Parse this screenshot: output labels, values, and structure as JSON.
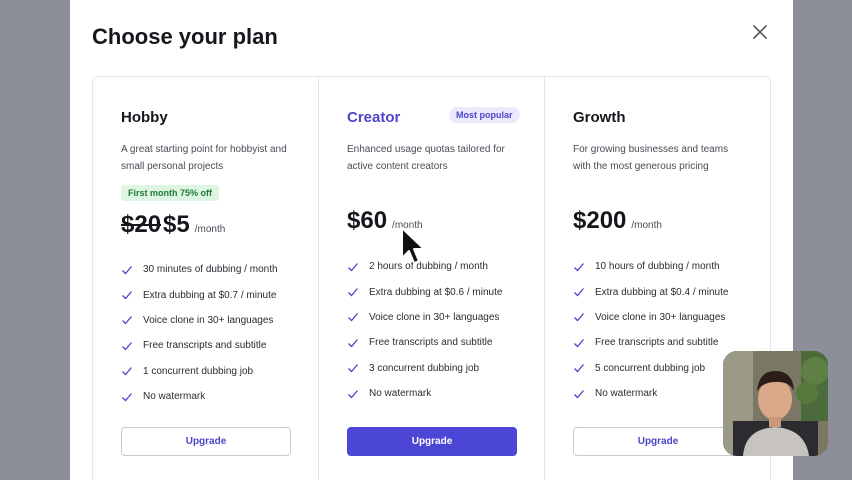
{
  "modal": {
    "title": "Choose your plan"
  },
  "colors": {
    "accent": "#4b46d6",
    "promo_bg": "#def5e2",
    "promo_text": "#1f7a37",
    "check": "#4b46c8"
  },
  "plans": [
    {
      "name": "Hobby",
      "description": "A great starting point for hobbyist and small personal projects",
      "promo": "First month 75% off",
      "price_old": "$20",
      "price": "$5",
      "unit": "/month",
      "features": [
        "30 minutes of dubbing / month",
        "Extra dubbing at $0.7 / minute",
        "Voice clone in 30+ languages",
        "Free transcripts and subtitle",
        "1 concurrent dubbing job",
        "No watermark"
      ],
      "button": "Upgrade"
    },
    {
      "name": "Creator",
      "badge": "Most popular",
      "description": "Enhanced usage quotas tailored for active content creators",
      "price": "$60",
      "unit": "/month",
      "features": [
        "2 hours of dubbing / month",
        "Extra dubbing at $0.6 / minute",
        "Voice clone in 30+ languages",
        "Free transcripts and subtitle",
        "3 concurrent dubbing job",
        "No watermark"
      ],
      "button": "Upgrade"
    },
    {
      "name": "Growth",
      "description": "For growing businesses and teams with the most generous pricing",
      "price": "$200",
      "unit": "/month",
      "features": [
        "10 hours of dubbing / month",
        "Extra dubbing at $0.4 / minute",
        "Voice clone in 30+ languages",
        "Free transcripts and subtitle",
        "5 concurrent dubbing job",
        "No watermark"
      ],
      "button": "Upgrade"
    }
  ],
  "icons": {
    "close": "close-icon",
    "check": "check-icon",
    "cursor": "mouse-cursor-icon"
  }
}
